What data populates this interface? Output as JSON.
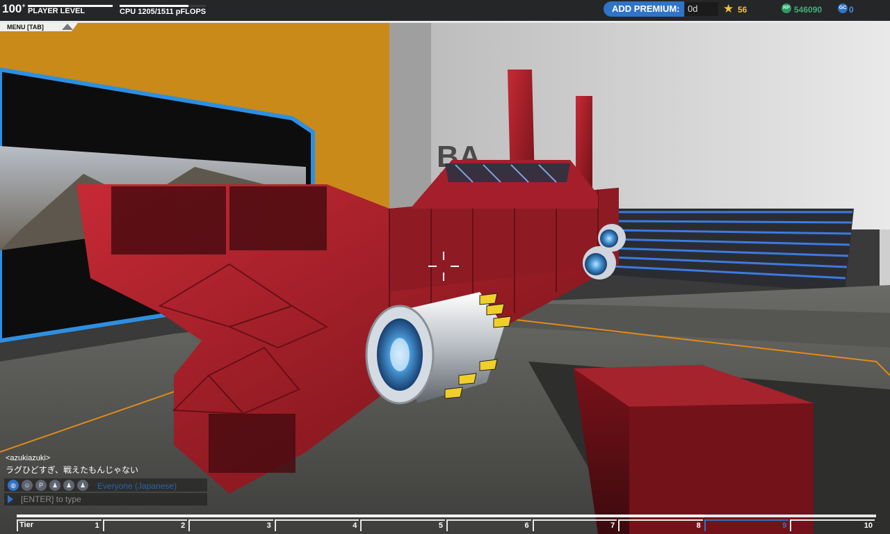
{
  "hud": {
    "player_level": "100",
    "level_suffix": "+",
    "player_level_label": "PLAYER LEVEL",
    "xp_progress": 1.0,
    "cpu_label": "CPU 1205/1511 pFLOPS",
    "cpu_used": 1205,
    "cpu_max": 1511,
    "add_premium_label": "ADD PREMIUM:",
    "premium_value": "0d",
    "stars": "56",
    "rp_icon": "RP",
    "rp": "546090",
    "gc_icon": "GC",
    "gc": "0",
    "menu_label": "MENU [TAB]"
  },
  "chat": {
    "username": "<azukiazuki>",
    "message": "ラグひどすぎ、戦えたもんじゃない",
    "channel_icons": [
      "globe-icon",
      "person-icon",
      "party-icon",
      "clan-icon",
      "friend-icon",
      "whisper-icon"
    ],
    "channel_icon_glyphs": [
      "◍",
      "☺",
      "P",
      "♟",
      "♟",
      "♟"
    ],
    "channel": "Everyone (Japanese)",
    "input_prompt": "[ENTER] to type"
  },
  "tier_bar": {
    "label": "Tier",
    "tiers": [
      "1",
      "2",
      "3",
      "4",
      "5",
      "6",
      "7",
      "8",
      "9",
      "10"
    ],
    "current_tier": "9"
  },
  "colors": {
    "accent": "#2f74c6",
    "star": "#f3c23a",
    "rp": "#3db07a",
    "robot_red": "#9e1f2a"
  }
}
